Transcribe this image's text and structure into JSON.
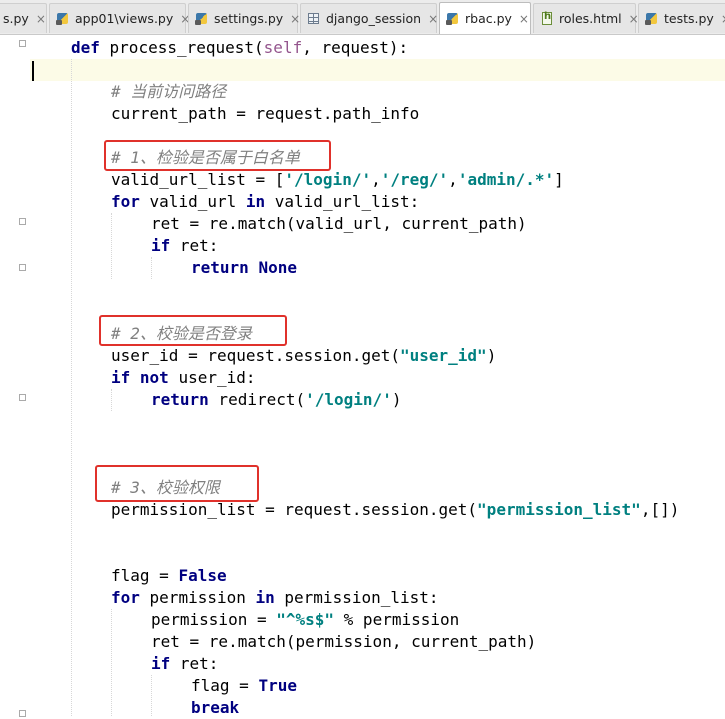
{
  "tabs": [
    {
      "label": "s.py",
      "icon": "python-file-icon"
    },
    {
      "label": "app01\\views.py",
      "icon": "python-file-icon"
    },
    {
      "label": "settings.py",
      "icon": "python-file-icon"
    },
    {
      "label": "django_session",
      "icon": "table-icon"
    },
    {
      "label": "rbac.py",
      "icon": "python-file-icon",
      "active": true
    },
    {
      "label": "roles.html",
      "icon": "html-file-icon"
    },
    {
      "label": "tests.py",
      "icon": "python-file-icon"
    }
  ],
  "close_glyph": "×",
  "code": {
    "def_kw": "def",
    "func_sig": " process_request(",
    "self_kw": "self",
    "func_sig_end": ", request):",
    "comment_path": "# 当前访问路径",
    "current_path": "current_path = request.path_info",
    "comment_whitelist": "# 1、检验是否属于白名单",
    "valid_url_list_prefix": "valid_url_list = [",
    "url_login": "'/login/'",
    "comma": ",",
    "url_reg": "'/reg/'",
    "url_admin": "'admin/.*'",
    "list_close": "]",
    "for_kw": "for",
    "for_valid_mid": " valid_url ",
    "in_kw": "in",
    "for_valid_end": " valid_url_list:",
    "ret_match_url": "ret = re.match(valid_url, current_path)",
    "if_kw": "if",
    "if_ret": " ret:",
    "return_kw": "return",
    "none_kw": "None",
    "comment_login": "# 2、校验是否登录",
    "user_id_prefix": "user_id = request.session.get(",
    "str_user_id": "\"user_id\"",
    "paren_close": ")",
    "not_kw": "not",
    "if_not_end": " user_id:",
    "redirect_prefix": " redirect(",
    "str_login": "'/login/'",
    "comment_perm": "# 3、校验权限",
    "perm_list_prefix": "permission_list = request.session.get(",
    "str_perm_list": "\"permission_list\"",
    "perm_list_end": ",[])",
    "flag_prefix": "flag = ",
    "false_kw": "False",
    "for_perm_mid": " permission ",
    "for_perm_end": " permission_list:",
    "perm_assign_prefix": "permission = ",
    "str_regex": "\"^%s$\"",
    "perm_assign_end": " % permission",
    "ret_match_perm": "ret = re.match(permission, current_path)",
    "true_kw": "True",
    "break_kw": "break"
  },
  "colors": {
    "keyword": "#000080",
    "string": "#008080",
    "comment": "#808080",
    "self": "#94558d",
    "highlight_box": "#e0312b"
  }
}
